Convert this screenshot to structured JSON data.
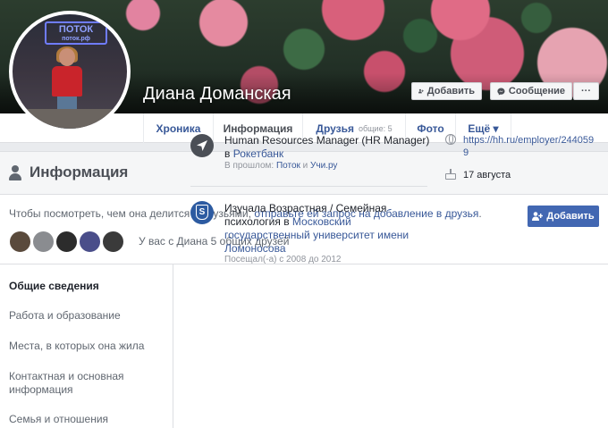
{
  "profile": {
    "name": "Диана Доманская",
    "photo_sign": "ПОТОК",
    "photo_sign_small": "поток.рф"
  },
  "cover_actions": {
    "add_label": "Добавить",
    "message_label": "Сообщение",
    "more_label": "···"
  },
  "tabs": [
    {
      "label": "Хроника"
    },
    {
      "label": "Информация"
    },
    {
      "label": "Друзья",
      "count": "общие: 5"
    },
    {
      "label": "Фото"
    },
    {
      "label": "Ещё ▾"
    }
  ],
  "info": {
    "title": "Информация",
    "request_prefix": "Чтобы посмотреть, чем она делится с друзьями, ",
    "request_link": "отправьте ей запрос на добавление в друзья",
    "request_suffix": ".",
    "add_button": "Добавить",
    "mutual_text": "У вас с Диана 5 общих друзей",
    "mutual_avatar_colors": [
      "#5a4a3c",
      "#8a8c90",
      "#2c2c2c",
      "#4a4e8a",
      "#3a3a3a"
    ]
  },
  "nav": {
    "general": "Общие сведения",
    "work": "Работа и образование",
    "places": "Места, в которых она жила",
    "contacts": "Контактная и основная информация",
    "family": "Семья и отношения"
  },
  "work": {
    "title": "Human Resources Manager (HR Manager)",
    "company_prefix": "в ",
    "company": "Рокетбанк",
    "past_prefix": "В прошлом: ",
    "past_1": "Поток",
    "past_and": " и ",
    "past_2": "Учи.ру"
  },
  "education": {
    "prefix": "Изучала Возрастная / Семейная психология в ",
    "school": "Московский государственный университет имени Ломоносова",
    "period": "Посещал(-а) с 2008 до 2012",
    "icon_letter": "S"
  },
  "contact": {
    "website": "https://hh.ru/employer/2440599",
    "birthday": "17 августа"
  },
  "colors": {
    "facebook_blue": "#4267b2",
    "link": "#385898"
  }
}
